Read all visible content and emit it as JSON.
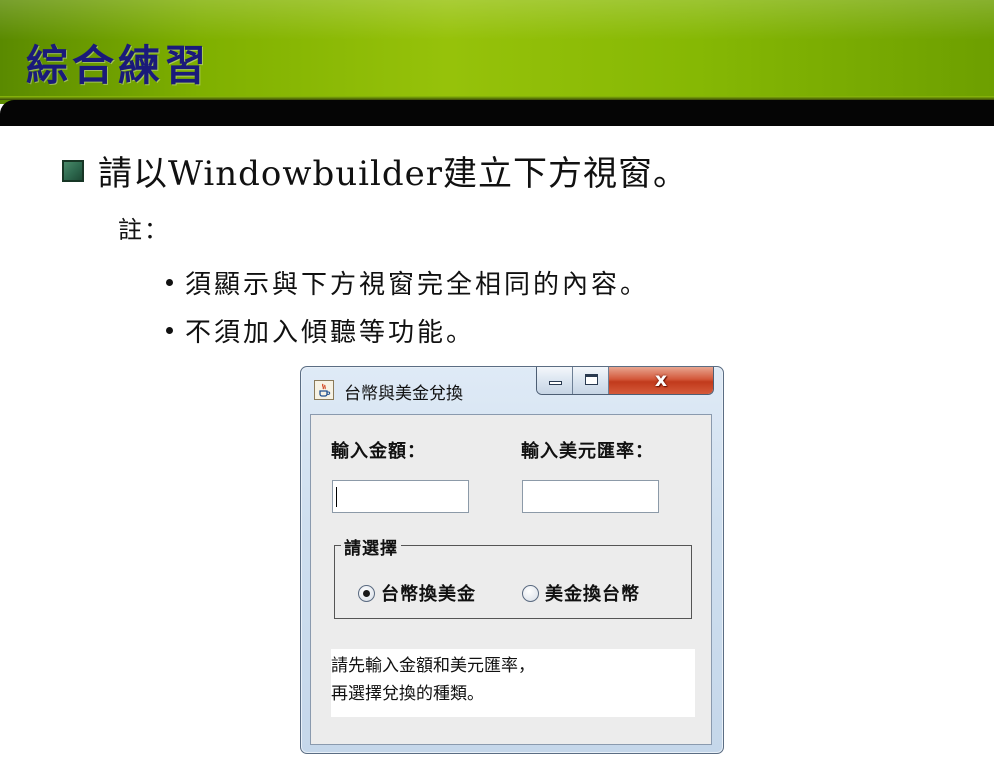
{
  "slide": {
    "title": "綜合練習",
    "main_bullet": "請以Windowbuilder建立下方視窗。",
    "note_label": "註：",
    "sub_items": [
      "須顯示與下方視窗完全相同的內容。",
      "不須加入傾聽等功能。"
    ]
  },
  "window": {
    "title": "台幣與美金兌換",
    "close_glyph": "x",
    "amount_label": "輸入金額：",
    "rate_label": "輸入美元匯率：",
    "amount_value": "",
    "rate_value": "",
    "group_title": "請選擇",
    "radio_options": [
      {
        "label": "台幣換美金",
        "selected": true
      },
      {
        "label": "美金換台幣",
        "selected": false
      }
    ],
    "message_lines": [
      "請先輸入金額和美元匯率，",
      "再選擇兌換的種類。"
    ]
  },
  "colors": {
    "header_green": "#86b804",
    "header_bar": "#050505",
    "title_text": "#1a1a7a",
    "close_red": "#c13a1c"
  },
  "icons": [
    "square-bullet-icon",
    "dot-icon",
    "java-cup-icon",
    "minimize-icon",
    "maximize-icon",
    "close-icon"
  ]
}
